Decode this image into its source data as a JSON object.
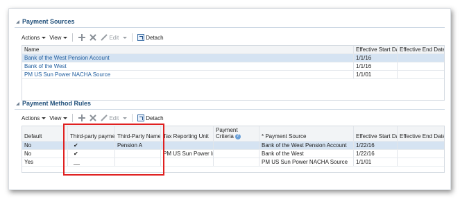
{
  "payment_sources": {
    "title": "Payment Sources",
    "toolbar": {
      "actions": "Actions",
      "view": "View",
      "edit": "Edit",
      "detach": "Detach"
    },
    "columns": [
      "Name",
      "Effective Start Date",
      "Effective End Date"
    ],
    "rows": [
      {
        "name": "Bank of the West Pension Account",
        "start": "1/1/16",
        "end": ""
      },
      {
        "name": "Bank of the West",
        "start": "1/1/16",
        "end": ""
      },
      {
        "name": "PM US Sun Power NACHA Source",
        "start": "1/1/01",
        "end": ""
      }
    ]
  },
  "payment_method_rules": {
    "title": "Payment Method Rules",
    "toolbar": {
      "actions": "Actions",
      "view": "View",
      "edit": "Edit",
      "detach": "Detach"
    },
    "columns": {
      "default": "Default",
      "third_party_payment": "Third-party payment",
      "third_party_name": "Third-Party Name",
      "tax_reporting_unit": "Tax Reporting Unit",
      "payment_criteria_line1": "Payment",
      "payment_criteria_line2": "Criteria",
      "payment_source": "* Payment Source",
      "start": "Effective Start Date",
      "end": "Effective End Date"
    },
    "rows": [
      {
        "default": "No",
        "third_party_payment": "✔",
        "third_party_name": "Pension A",
        "tax_reporting_unit": "",
        "payment_source": "Bank of the West Pension Account",
        "start": "1/22/16",
        "end": ""
      },
      {
        "default": "No",
        "third_party_payment": "✔",
        "third_party_name": "",
        "tax_reporting_unit": "PM US Sun Power Inc",
        "payment_source": "Bank of the West",
        "start": "1/22/16",
        "end": ""
      },
      {
        "default": "Yes",
        "third_party_payment": "__",
        "third_party_name": "",
        "tax_reporting_unit": "",
        "payment_source": "PM US Sun Power NACHA Source",
        "start": "1/1/01",
        "end": ""
      }
    ]
  },
  "colors": {
    "accent_title": "#1f4e79",
    "link": "#1f5d9e",
    "selected_row": "#d5e3f2",
    "highlight_box": "#e02020"
  },
  "icons": {
    "add": "plus-icon",
    "delete": "x-icon",
    "edit": "pencil-icon",
    "detach": "detach-icon",
    "help": "help-icon"
  }
}
